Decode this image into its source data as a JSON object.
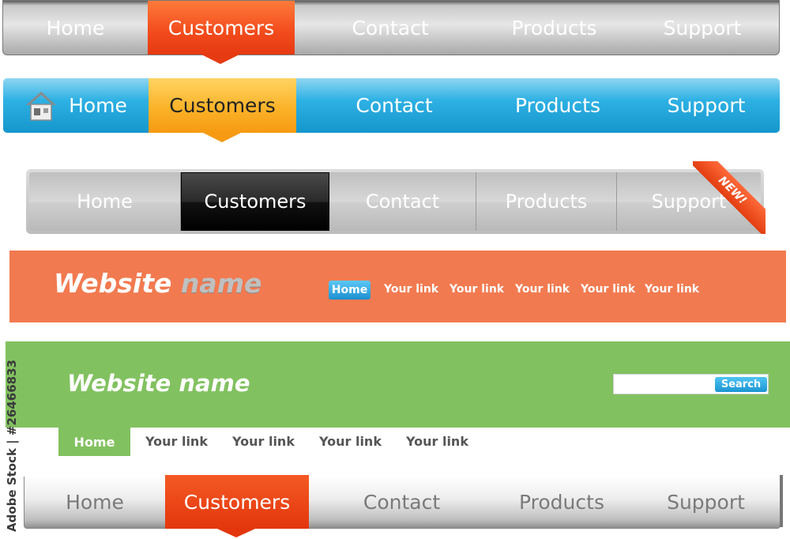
{
  "nav1": {
    "items": [
      "Home",
      "Customers",
      "Contact",
      "Products",
      "Support"
    ],
    "active": "Customers",
    "colors": {
      "bar": "#c9c9c9",
      "active": "#f24a1c"
    }
  },
  "nav2": {
    "items": [
      "Home",
      "Customers",
      "Contact",
      "Products",
      "Support"
    ],
    "active": "Customers",
    "home_icon": "house-icon",
    "colors": {
      "bar": "#2eb1e4",
      "active": "#fbb329"
    }
  },
  "nav3": {
    "items": [
      "Home",
      "Customers",
      "Contact",
      "Products",
      "Support"
    ],
    "active": "Customers",
    "ribbon": "NEW!",
    "colors": {
      "bar": "#c8c8c8",
      "active": "#111111",
      "ribbon": "#e23e10"
    }
  },
  "header_orange": {
    "site_name_part1": "Website",
    "site_name_part2": "name",
    "home": "Home",
    "links": [
      "Your link",
      "Your link",
      "Your link",
      "Your link",
      "Your link"
    ],
    "colors": {
      "background": "#f27a50",
      "home_pill": "#1c8fd0"
    }
  },
  "header_green": {
    "site_name": "Website name",
    "search_button": "Search",
    "search_value": "",
    "home": "Home",
    "links": [
      "Your link",
      "Your link",
      "Your link",
      "Your link"
    ],
    "colors": {
      "background": "#82c160",
      "search_button": "#1b95d2"
    }
  },
  "nav4": {
    "items": [
      "Home",
      "Customers",
      "Contact",
      "Products",
      "Support"
    ],
    "active": "Customers",
    "colors": {
      "bar": "#ececec",
      "active": "#ea4416"
    }
  },
  "stock_credit": "Adobe Stock | #26466833"
}
